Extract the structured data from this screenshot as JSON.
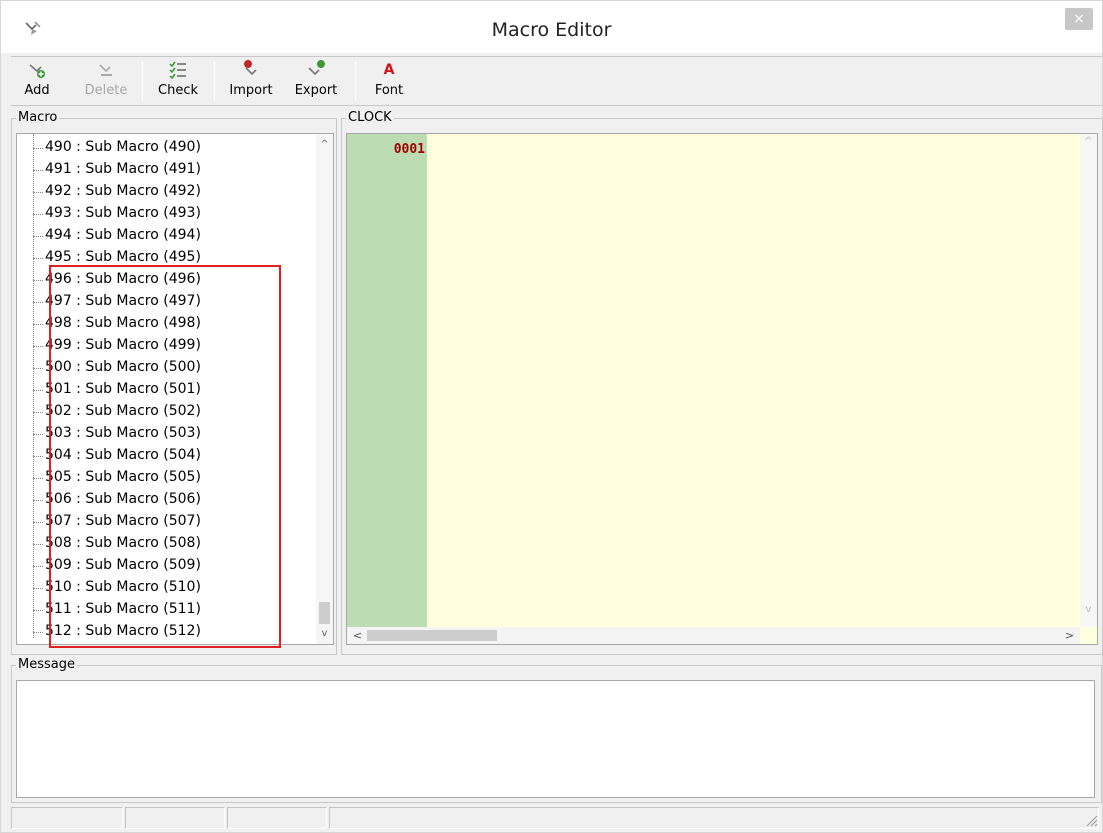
{
  "window": {
    "title": "Macro Editor",
    "close_label": "×",
    "app_icon": "macro-pen-icon"
  },
  "toolbar": {
    "add_label": "Add",
    "delete_label": "Delete",
    "check_label": "Check",
    "import_label": "Import",
    "export_label": "Export",
    "font_label": "Font",
    "font_glyph": "A"
  },
  "macro_panel": {
    "label": "Macro",
    "items": [
      "490 : Sub Macro (490)",
      "491 : Sub Macro (491)",
      "492 : Sub Macro (492)",
      "493 : Sub Macro (493)",
      "494 : Sub Macro (494)",
      "495 : Sub Macro (495)",
      "496 : Sub Macro (496)",
      "497 : Sub Macro (497)",
      "498 : Sub Macro (498)",
      "499 : Sub Macro (499)",
      "500 : Sub Macro (500)",
      "501 : Sub Macro (501)",
      "502 : Sub Macro (502)",
      "503 : Sub Macro (503)",
      "504 : Sub Macro (504)",
      "505 : Sub Macro (505)",
      "506 : Sub Macro (506)",
      "507 : Sub Macro (507)",
      "508 : Sub Macro (508)",
      "509 : Sub Macro (509)",
      "510 : Sub Macro (510)",
      "511 : Sub Macro (511)",
      "512 : Sub Macro (512)"
    ],
    "highlight_color": "#e02020"
  },
  "editor": {
    "label": "CLOCK",
    "line_number": "0001",
    "background_color": "#ffffde",
    "gutter_color": "#bcdcb4",
    "line_number_color": "#a00000"
  },
  "message_panel": {
    "label": "Message"
  },
  "scroll": {
    "up": "^",
    "down": "v",
    "left": "<",
    "right": ">"
  }
}
